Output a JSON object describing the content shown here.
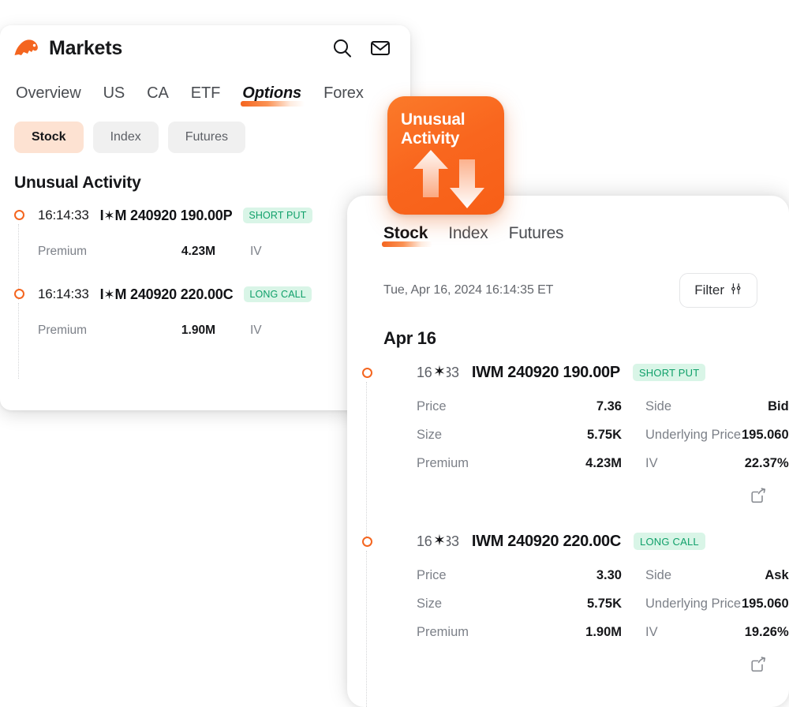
{
  "theme": {
    "accent_orange": "#f4651f",
    "tag_green_text": "#10a06a",
    "tag_green_bg": "#d9f5e7",
    "active_pill_bg": "#fde2d2",
    "pill_bg": "#f0f0f0",
    "text_primary": "#16171a",
    "text_muted": "#7c8088"
  },
  "left_card": {
    "header": {
      "logo_icon": "markets-bull-logo",
      "title": "Markets",
      "search_icon": "search-icon",
      "mail_icon": "mail-icon"
    },
    "tabs": [
      {
        "label": "Overview",
        "active": false
      },
      {
        "label": "US",
        "active": false
      },
      {
        "label": "CA",
        "active": false
      },
      {
        "label": "ETF",
        "active": false
      },
      {
        "label": "Options",
        "active": true
      },
      {
        "label": "Forex",
        "active": false
      }
    ],
    "pills": [
      {
        "label": "Stock",
        "active": true
      },
      {
        "label": "Index",
        "active": false
      },
      {
        "label": "Futures",
        "active": false
      }
    ],
    "section_title": "Unusual Activity",
    "rows": [
      {
        "time": "16:14:33",
        "ticker_prefix": "I",
        "ticker_star": "✶",
        "ticker_suffix": "M",
        "contract": "240920 190.00P",
        "tag": "SHORT PUT",
        "premium_label": "Premium",
        "premium_value": "4.23M",
        "iv_label": "IV",
        "iv_value": ""
      },
      {
        "time": "16:14:33",
        "ticker_prefix": "I",
        "ticker_star": "✶",
        "ticker_suffix": "M",
        "contract": "240920 220.00C",
        "tag": "LONG CALL",
        "premium_label": "Premium",
        "premium_value": "1.90M",
        "iv_label": "IV",
        "iv_value": ""
      }
    ]
  },
  "badge": {
    "line1": "Unusual",
    "line2": "Activity",
    "icon": "up-down-arrows-icon"
  },
  "right_card": {
    "tabs": [
      {
        "label": "Stock",
        "active": true
      },
      {
        "label": "Index",
        "active": false
      },
      {
        "label": "Futures",
        "active": false
      }
    ],
    "timestamp": "Tue, Apr 16, 2024 16:14:35 ET",
    "filter_label": "Filter",
    "filter_icon": "sliders-icon",
    "date_header": "Apr 16",
    "rows": [
      {
        "time_prefix": "16",
        "time_star": "✶",
        "time_suffix": "4:33",
        "contract": "IWM 240920 190.00P",
        "tag": "SHORT PUT",
        "stats": [
          {
            "k": "Price",
            "v": "7.36",
            "k2": "Side",
            "v2": "Bid"
          },
          {
            "k": "Size",
            "v": "5.75K",
            "k2": "Underlying Price",
            "v2": "195.060"
          },
          {
            "k": "Premium",
            "v": "4.23M",
            "k2": "IV",
            "v2": "22.37%"
          }
        ],
        "share_icon": "share-icon"
      },
      {
        "time_prefix": "16",
        "time_star": "✶",
        "time_suffix": "4:33",
        "contract": "IWM 240920 220.00C",
        "tag": "LONG CALL",
        "stats": [
          {
            "k": "Price",
            "v": "3.30",
            "k2": "Side",
            "v2": "Ask"
          },
          {
            "k": "Size",
            "v": "5.75K",
            "k2": "Underlying Price",
            "v2": "195.060"
          },
          {
            "k": "Premium",
            "v": "1.90M",
            "k2": "IV",
            "v2": "19.26%"
          }
        ],
        "share_icon": "share-icon"
      }
    ]
  }
}
